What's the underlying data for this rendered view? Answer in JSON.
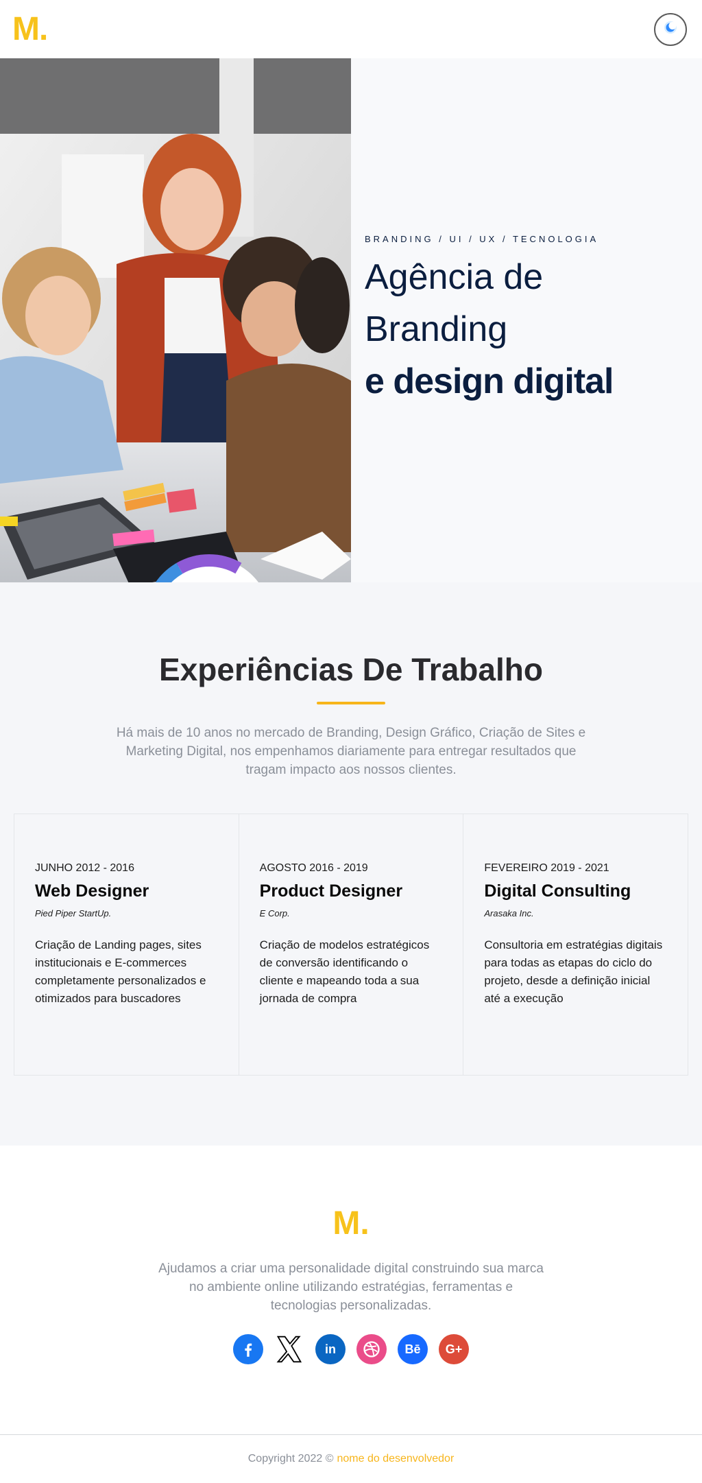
{
  "header": {
    "logo_text": "M",
    "logo_dot": ".",
    "theme_toggle_icon": "moon-icon"
  },
  "hero": {
    "kicker": "BRANDING / UI / UX / TECNOLOGIA",
    "title_line1": "Agência de",
    "title_line2": "Branding",
    "title_line3": "e design digital",
    "image_alt": "team-working-photo"
  },
  "experience": {
    "title": "Experiências De Trabalho",
    "description": "Há mais de 10 anos no mercado de Branding, Design Gráfico, Criação de Sites e Marketing Digital, nos empenhamos diariamente para entregar resultados que tragam impacto aos nossos clientes.",
    "cards": [
      {
        "date": "JUNHO 2012 - 2016",
        "title": "Web Designer",
        "company": "Pied Piper StartUp.",
        "text": "Criação de Landing pages, sites institucionais e E-commerces completamente personalizados e otimizados para buscadores"
      },
      {
        "date": "AGOSTO 2016 - 2019",
        "title": "Product Designer",
        "company": "E Corp.",
        "text": "Criação de modelos estratégicos de conversão identificando o cliente e mapeando toda a sua jornada de compra"
      },
      {
        "date": "FEVEREIRO 2019 - 2021",
        "title": "Digital Consulting",
        "company": "Arasaka Inc.",
        "text": "Consultoria em estratégias digitais para todas as etapas do ciclo do projeto, desde a definição inicial até a execução"
      }
    ]
  },
  "footer": {
    "logo_text": "M.",
    "description": "Ajudamos a criar uma personalidade digital construindo sua marca no ambiente online utilizando estratégias, ferramentas e tecnologias personalizadas.",
    "socials": [
      {
        "name": "facebook-icon",
        "color": "#1877f2"
      },
      {
        "name": "x-icon",
        "color": "#000000"
      },
      {
        "name": "linkedin-icon",
        "color": "#0a66c2"
      },
      {
        "name": "dribbble-icon",
        "color": "#ea4c89"
      },
      {
        "name": "behance-icon",
        "color": "#1769ff"
      },
      {
        "name": "google-plus-icon",
        "color": "#dd4b39"
      }
    ],
    "behance_label": "Bē",
    "google_label": "G+",
    "linkedin_label": "in",
    "copyright": "Copyright 2022 ©",
    "developer": "nome do desenvolvedor"
  },
  "colors": {
    "accent": "#f7c21b",
    "navy": "#0b1e3f",
    "muted": "#8a8f98"
  }
}
